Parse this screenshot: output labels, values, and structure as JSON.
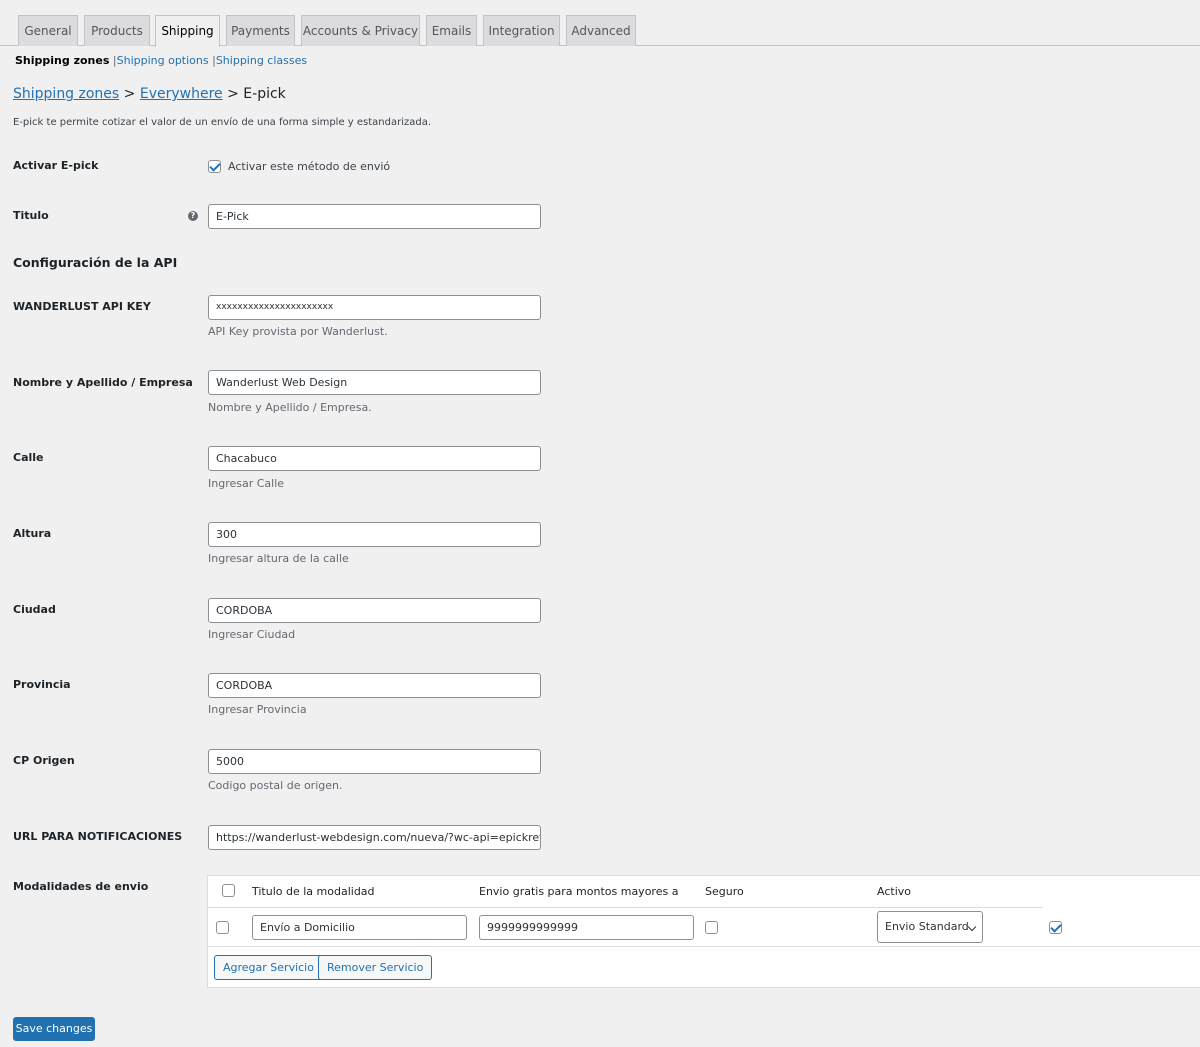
{
  "tabs": [
    "General",
    "Products",
    "Shipping",
    "Payments",
    "Accounts & Privacy",
    "Emails",
    "Integration",
    "Advanced"
  ],
  "active_tab": "Shipping",
  "subnav": {
    "current": "Shipping zones",
    "links": [
      "Shipping options",
      "Shipping classes"
    ]
  },
  "breadcrumb": {
    "zones_link": "Shipping zones",
    "zone_link": "Everywhere",
    "current": "E-pick",
    "separator": ">"
  },
  "description": "E-pick te permite cotizar el valor de un envío de una forma simple y estandarizada.",
  "form": {
    "activar": {
      "label": "Activar E-pick",
      "checkbox_label": "Activar este método de envió",
      "checked": true
    },
    "titulo": {
      "label": "Titulo",
      "value": "E-Pick",
      "help_icon": "help-icon"
    },
    "api_section": "Configuración de la API",
    "api_key": {
      "label": "WANDERLUST API KEY",
      "value": "xxxxxxxxxxxxxxxxxxxxxx",
      "hint": "API Key provista por Wanderlust."
    },
    "nombre": {
      "label": "Nombre y Apellido / Empresa",
      "value": "Wanderlust Web Design",
      "hint": "Nombre y Apellido / Empresa."
    },
    "calle": {
      "label": "Calle",
      "value": "Chacabuco",
      "hint": "Ingresar Calle"
    },
    "altura": {
      "label": "Altura",
      "value": "300",
      "hint": "Ingresar altura de la calle"
    },
    "ciudad": {
      "label": "Ciudad",
      "value": "CORDOBA",
      "hint": "Ingresar Ciudad"
    },
    "provincia": {
      "label": "Provincia",
      "value": "CORDOBA",
      "hint": "Ingresar Provincia"
    },
    "cp": {
      "label": "CP Origen",
      "value": "5000",
      "hint": "Codigo postal de origen."
    },
    "url": {
      "label": "URL PARA NOTIFICACIONES",
      "value": "https://wanderlust-webdesign.com/nueva/?wc-api=epickretur"
    },
    "modalidades": {
      "label": "Modalidades de envio",
      "headers": [
        "Titulo de la modalidad",
        "Envio gratis para montos mayores a",
        "Seguro",
        "Activo"
      ],
      "rows": [
        {
          "titulo": "Envío a Domicilio",
          "monto": "9999999999999",
          "seguro": false,
          "tipo": "Envio Standard",
          "activo": true
        }
      ],
      "add_button": "Agregar Servicio",
      "remove_button": "Remover Servicio"
    }
  },
  "save_button": "Save changes",
  "colors": {
    "accent": "#2271b1",
    "background": "#f0f0f1"
  }
}
